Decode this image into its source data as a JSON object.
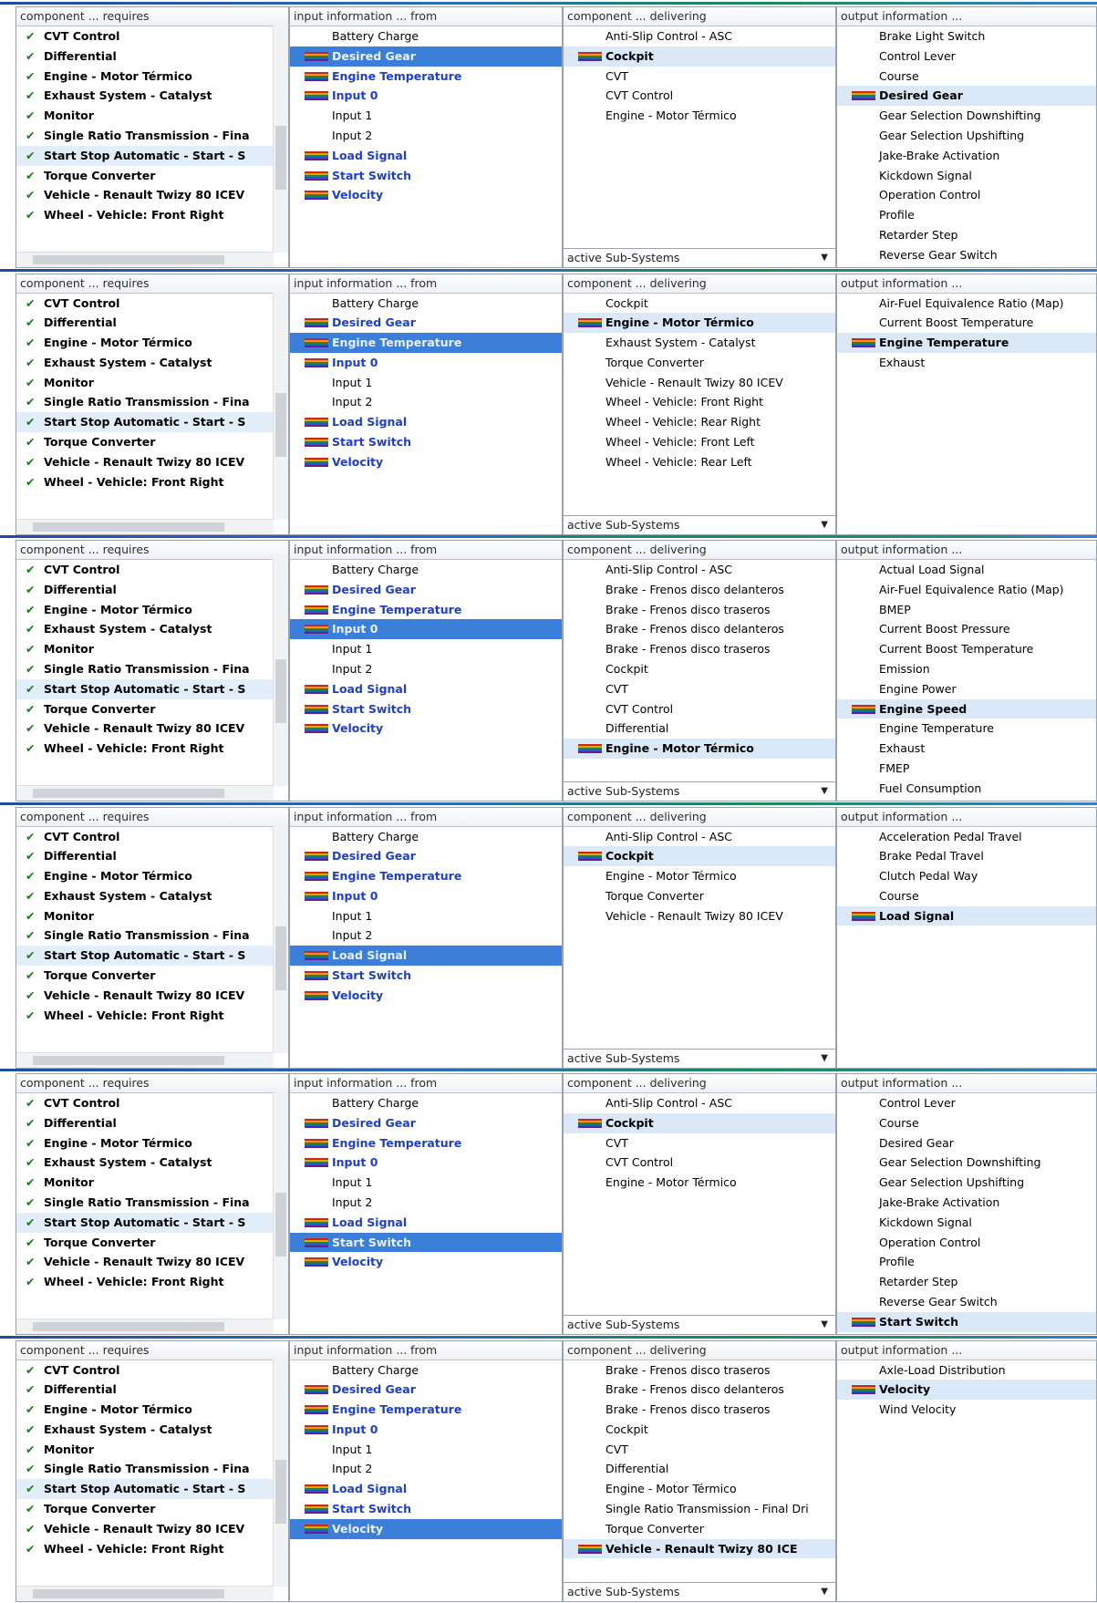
{
  "headers": {
    "requires": "component ... requires",
    "input": "input information ... from",
    "delivering": "component ... delivering",
    "output": "output information ..."
  },
  "dropdown_label": "active Sub-Systems",
  "components": [
    "CVT Control",
    "Differential",
    "Engine - Motor Térmico",
    "Exhaust System - Catalyst",
    "Monitor",
    "Single Ratio Transmission - Fina",
    "Start Stop Automatic - Start - S",
    "Torque Converter",
    "Vehicle - Renault Twizy 80 ICEV",
    "Wheel - Vehicle: Front Right"
  ],
  "selected_component": "Start Stop Automatic - Start - S",
  "inputs": [
    {
      "label": "Battery Charge",
      "bold": false
    },
    {
      "label": "Desired Gear",
      "bold": true
    },
    {
      "label": "Engine Temperature",
      "bold": true
    },
    {
      "label": "Input 0",
      "bold": true
    },
    {
      "label": "Input 1",
      "bold": false
    },
    {
      "label": "Input 2",
      "bold": false
    },
    {
      "label": "Load Signal",
      "bold": true
    },
    {
      "label": "Start Switch",
      "bold": true
    },
    {
      "label": "Velocity",
      "bold": true
    }
  ],
  "panels": [
    {
      "selected_input": "Desired Gear",
      "delivering": [
        "Anti-Slip Control - ASC",
        "Cockpit",
        "CVT",
        "CVT Control",
        "Engine - Motor Térmico"
      ],
      "delivering_selected": "Cockpit",
      "output": [
        "Brake Light Switch",
        "Control Lever",
        "Course",
        "Desired Gear",
        "Gear Selection Downshifting",
        "Gear Selection Upshifting",
        "Jake-Brake Activation",
        "Kickdown Signal",
        "Operation Control",
        "Profile",
        "Retarder Step",
        "Reverse Gear Switch"
      ],
      "output_selected": "Desired Gear"
    },
    {
      "selected_input": "Engine Temperature",
      "delivering": [
        "Cockpit",
        "Engine - Motor Térmico",
        "Exhaust System - Catalyst",
        "Torque Converter",
        "Vehicle - Renault Twizy 80 ICEV",
        "Wheel - Vehicle: Front Right",
        "Wheel - Vehicle: Rear Right",
        "Wheel - Vehicle: Front Left",
        "Wheel - Vehicle: Rear Left"
      ],
      "delivering_selected": "Engine - Motor Térmico",
      "output": [
        "Air-Fuel Equivalence Ratio (Map)",
        "Current Boost Temperature",
        "Engine Temperature",
        "Exhaust"
      ],
      "output_selected": "Engine Temperature"
    },
    {
      "selected_input": "Input 0",
      "delivering": [
        "Anti-Slip Control - ASC",
        "Brake - Frenos disco delanteros",
        "Brake - Frenos disco traseros",
        "Brake - Frenos disco delanteros",
        "Brake - Frenos disco traseros",
        "Cockpit",
        "CVT",
        "CVT Control",
        "Differential",
        "Engine - Motor Térmico"
      ],
      "delivering_selected": "Engine - Motor Térmico",
      "output": [
        "Actual Load Signal",
        "Air-Fuel Equivalence Ratio (Map)",
        "BMEP",
        "Current Boost Pressure",
        "Current Boost Temperature",
        "Emission",
        "Engine Power",
        "Engine Speed",
        "Engine Temperature",
        "Exhaust",
        "FMEP",
        "Fuel Consumption"
      ],
      "output_selected": "Engine Speed"
    },
    {
      "selected_input": "Load Signal",
      "delivering": [
        "Anti-Slip Control - ASC",
        "Cockpit",
        "Engine - Motor Térmico",
        "Torque Converter",
        "Vehicle - Renault Twizy 80 ICEV"
      ],
      "delivering_selected": "Cockpit",
      "output": [
        "Acceleration Pedal Travel",
        "Brake Pedal Travel",
        "Clutch Pedal Way",
        "Course",
        "Load Signal"
      ],
      "output_selected": "Load Signal"
    },
    {
      "selected_input": "Start Switch",
      "delivering": [
        "Anti-Slip Control - ASC",
        "Cockpit",
        "CVT",
        "CVT Control",
        "Engine - Motor Térmico"
      ],
      "delivering_selected": "Cockpit",
      "output": [
        "Control Lever",
        "Course",
        "Desired Gear",
        "Gear Selection Downshifting",
        "Gear Selection Upshifting",
        "Jake-Brake Activation",
        "Kickdown Signal",
        "Operation Control",
        "Profile",
        "Retarder Step",
        "Reverse Gear Switch",
        "Start Switch"
      ],
      "output_selected": "Start Switch"
    },
    {
      "selected_input": "Velocity",
      "delivering": [
        "Brake - Frenos disco traseros",
        "Brake - Frenos disco delanteros",
        "Brake - Frenos disco traseros",
        "Cockpit",
        "CVT",
        "Differential",
        "Engine - Motor Térmico",
        "Single Ratio Transmission - Final Dri",
        "Torque Converter",
        "Vehicle - Renault Twizy 80 ICE"
      ],
      "delivering_selected": "Vehicle - Renault Twizy 80 ICE",
      "output": [
        "Axle-Load Distribution",
        "Velocity",
        "Wind Velocity"
      ],
      "output_selected": "Velocity"
    }
  ]
}
